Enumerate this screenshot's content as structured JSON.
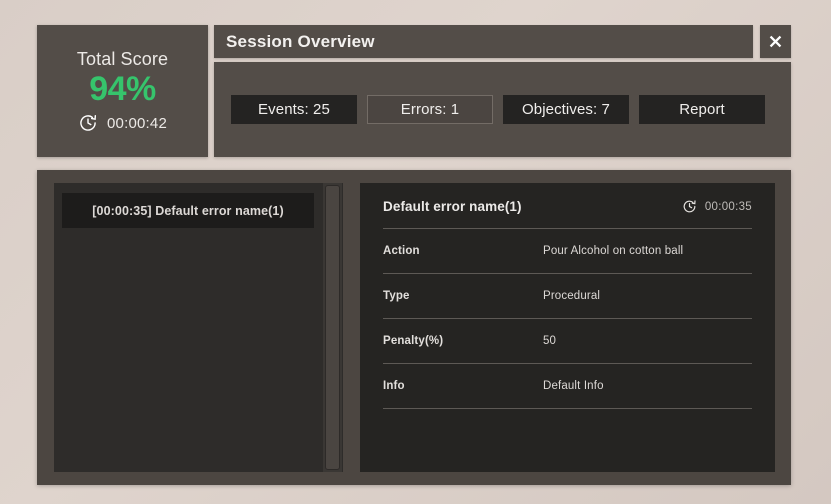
{
  "score_card": {
    "title": "Total Score",
    "value": "94%",
    "time": "00:00:42",
    "clock_icon": "history-clock-icon",
    "accent_color": "#36c46c"
  },
  "title_bar": {
    "title": "Session Overview",
    "close_icon": "close-icon",
    "close_label": "✕"
  },
  "stats": {
    "buttons": [
      {
        "label": "Events: 25",
        "active": false
      },
      {
        "label": "Errors: 1",
        "active": true
      },
      {
        "label": "Objectives: 7",
        "active": false
      },
      {
        "label": "Report",
        "active": false
      }
    ]
  },
  "error_list": {
    "items": [
      {
        "label": "[00:00:35] Default error name(1)",
        "selected": true
      }
    ],
    "scrollbar": "vertical-scrollbar"
  },
  "detail": {
    "title": "Default error name(1)",
    "time": "00:00:35",
    "clock_icon": "history-clock-icon",
    "rows": [
      {
        "label": "Action",
        "value": "Pour Alcohol on cotton ball"
      },
      {
        "label": "Type",
        "value": "Procedural"
      },
      {
        "label": "Penalty(%)",
        "value": "50"
      },
      {
        "label": "Info",
        "value": "Default Info"
      }
    ]
  },
  "theme": {
    "panel": "#534d48",
    "panel_dark": "#252422",
    "list_bg": "#2e2c2a",
    "item_bg": "#1d1c1b",
    "background": "#d9cec7"
  }
}
